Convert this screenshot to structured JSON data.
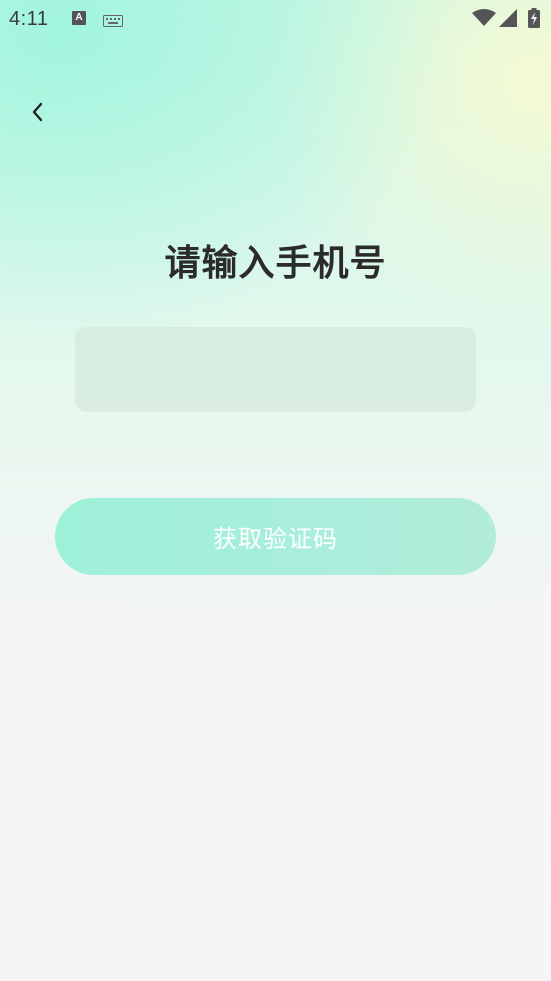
{
  "status_bar": {
    "time": "4:11",
    "a_icon_letter": "A",
    "icons": [
      "a-notification-icon",
      "keyboard-icon",
      "wifi-icon",
      "signal-icon",
      "battery-charging-icon"
    ]
  },
  "header": {
    "back_icon": "chevron-left-icon"
  },
  "main": {
    "title": "请输入手机号",
    "phone_input": {
      "value": "",
      "placeholder": ""
    },
    "get_code_label": "获取验证码"
  },
  "colors": {
    "accent": "#9ef0d9",
    "title_text": "#2b2b2b",
    "button_text": "#ffffff"
  }
}
